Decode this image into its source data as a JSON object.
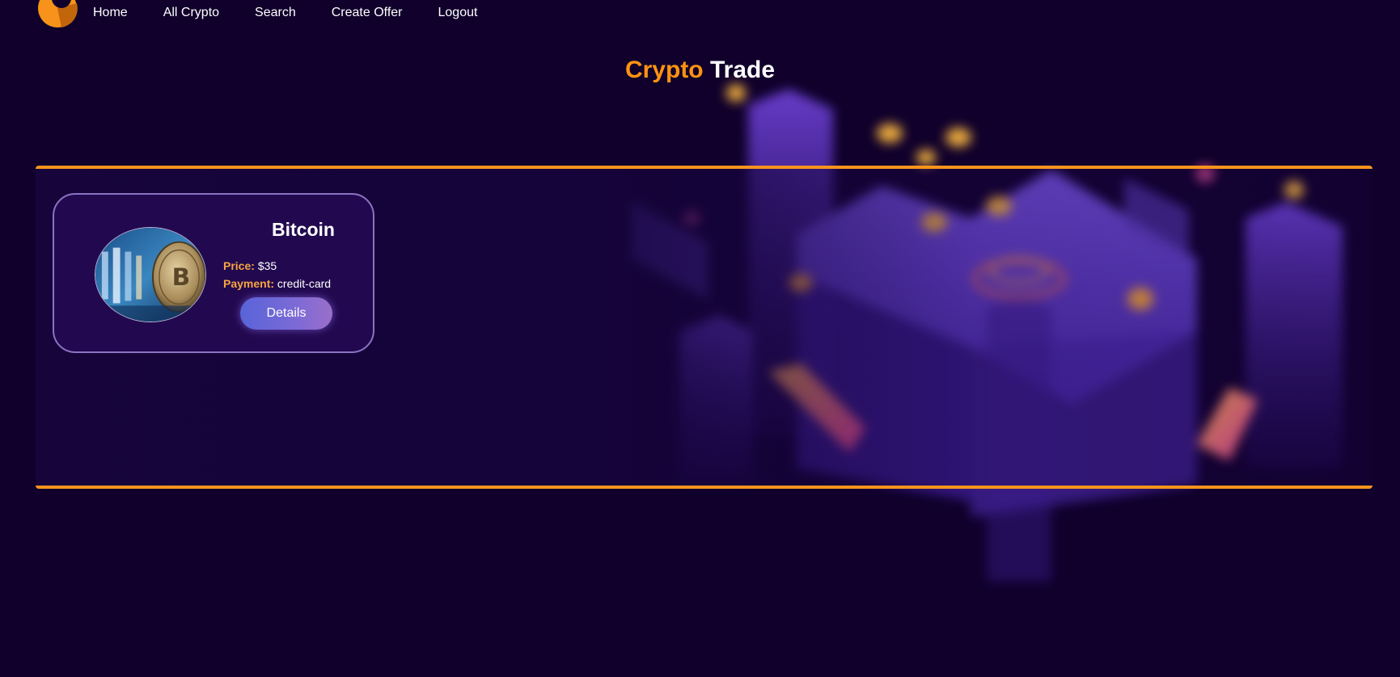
{
  "nav": {
    "logo_icon": "crypto-logo-icon",
    "items": [
      {
        "label": "Home"
      },
      {
        "label": "All Crypto"
      },
      {
        "label": "Search"
      },
      {
        "label": "Create Offer"
      },
      {
        "label": "Logout"
      }
    ]
  },
  "header": {
    "title_accent": "Crypto",
    "title_main": "Trade"
  },
  "catalog": {
    "cards": [
      {
        "name": "Bitcoin",
        "image_icon": "bitcoin-coin-image",
        "price_label": "Price:",
        "price_value": "$35",
        "payment_label": "Payment:",
        "payment_value": "credit-card",
        "details_label": "Details"
      }
    ]
  },
  "colors": {
    "background": "#10002b",
    "accent": "#f7941d",
    "card_background": "#22094f",
    "card_border": "#8c72c2",
    "button_gradient_start": "#5864d8",
    "button_gradient_end": "#9a6fc9"
  }
}
